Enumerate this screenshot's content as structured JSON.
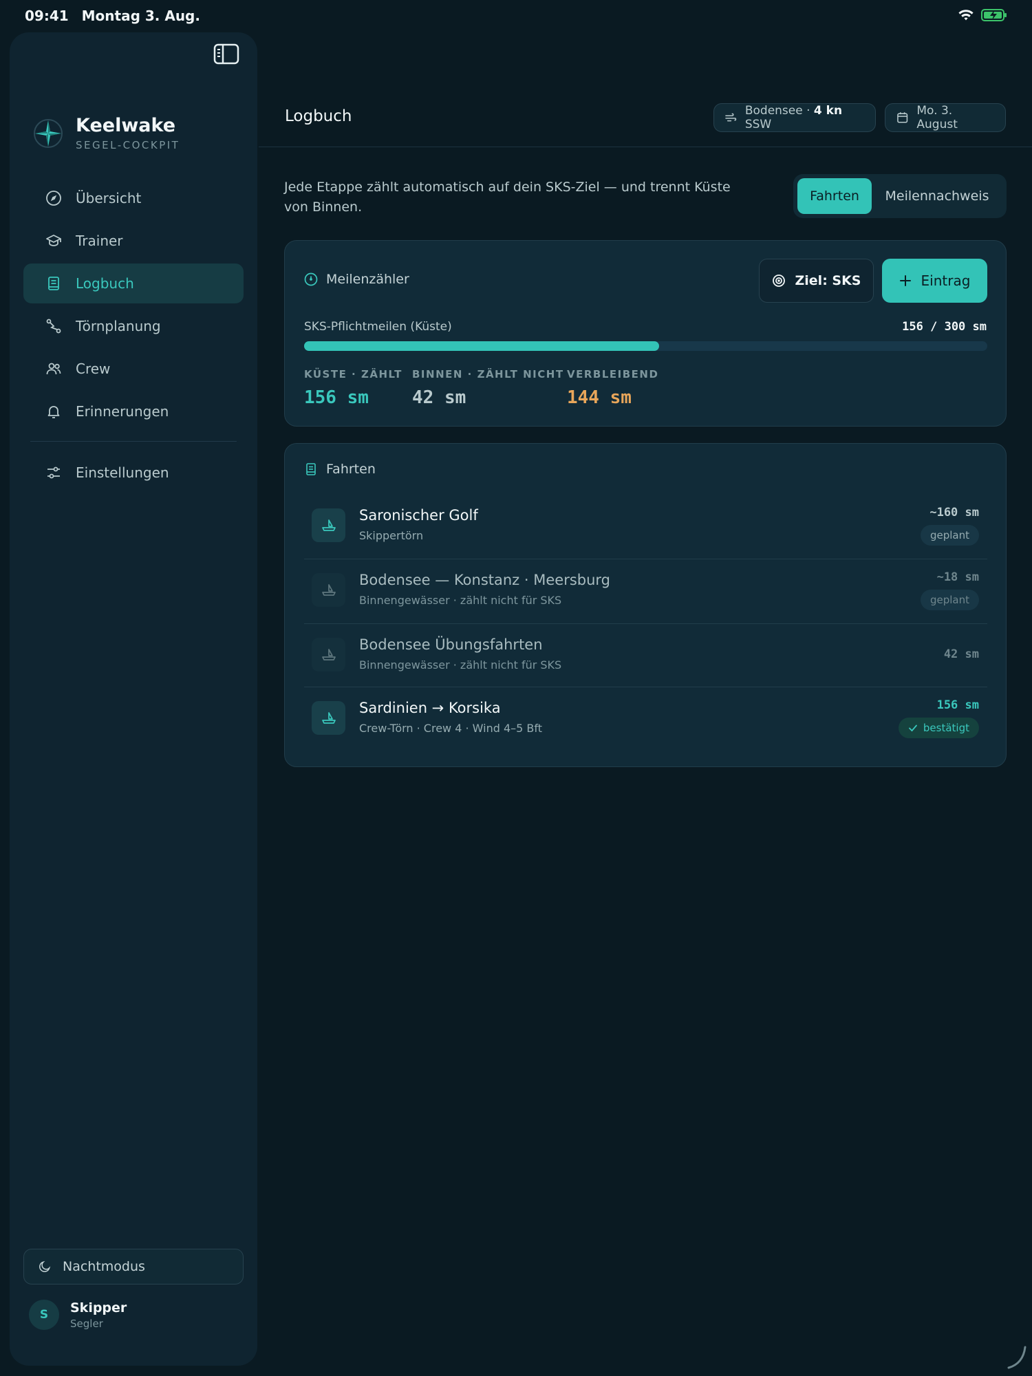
{
  "status_bar": {
    "time": "09:41",
    "date": "Montag 3. Aug."
  },
  "brand": {
    "name": "Keelwake",
    "subtitle": "SEGEL-COCKPIT"
  },
  "nav": {
    "items": [
      {
        "label": "Übersicht",
        "icon": "compass-icon"
      },
      {
        "label": "Trainer",
        "icon": "graduation-cap-icon"
      },
      {
        "label": "Logbuch",
        "icon": "book-icon",
        "active": true
      },
      {
        "label": "Törnplanung",
        "icon": "route-icon"
      },
      {
        "label": "Crew",
        "icon": "users-icon"
      },
      {
        "label": "Erinnerungen",
        "icon": "bell-icon"
      }
    ],
    "settings": {
      "label": "Einstellungen",
      "icon": "sliders-icon"
    }
  },
  "night_mode": {
    "label": "Nachtmodus"
  },
  "user": {
    "initial": "S",
    "name": "Skipper",
    "role": "Segler"
  },
  "header": {
    "title": "Logbuch",
    "weather": {
      "place": "Bodensee ·",
      "wind": "4 kn",
      "direction": "SSW"
    },
    "date": "Mo. 3. August"
  },
  "intro": "Jede Etappe zählt automatisch auf dein SKS-Ziel — und trennt Küste von Binnen.",
  "tabs": [
    {
      "label": "Fahrten",
      "active": true
    },
    {
      "label": "Meilennachweis",
      "active": false
    }
  ],
  "mileage": {
    "title": "Meilenzähler",
    "goal_button": "Ziel: SKS",
    "add_button": "Eintrag",
    "progress_label": "SKS-Pflichtmeilen (Küste)",
    "progress_text": "156 / 300 sm",
    "progress_fraction": 0.52,
    "stats": [
      {
        "label": "KÜSTE · ZÄHLT",
        "value": "156 sm"
      },
      {
        "label": "BINNEN · ZÄHLT NICHT",
        "value": "42 sm"
      },
      {
        "label": "VERBLEIBEND",
        "value": "144 sm"
      }
    ]
  },
  "trips": {
    "title": "Fahrten",
    "items": [
      {
        "title": "Saronischer Golf",
        "subtitle": "Skippertörn",
        "miles": "~160 sm",
        "badge": "geplant"
      },
      {
        "title": "Bodensee — Konstanz · Meersburg",
        "subtitle": "Binnengewässer · zählt nicht für SKS",
        "miles": "~18 sm",
        "badge": "geplant"
      },
      {
        "title": "Bodensee Übungsfahrten",
        "subtitle": "Binnengewässer · zählt nicht für SKS",
        "miles": "42 sm"
      },
      {
        "title": "Sardinien → Korsika",
        "subtitle": "Crew-Törn · Crew 4 · Wind 4–5 Bft",
        "miles": "156 sm",
        "badge": "bestätigt"
      }
    ]
  },
  "colors": {
    "accent": "#33c3b7",
    "warning": "#e8a65a",
    "background": "#0a1a22",
    "card": "#112b38"
  }
}
